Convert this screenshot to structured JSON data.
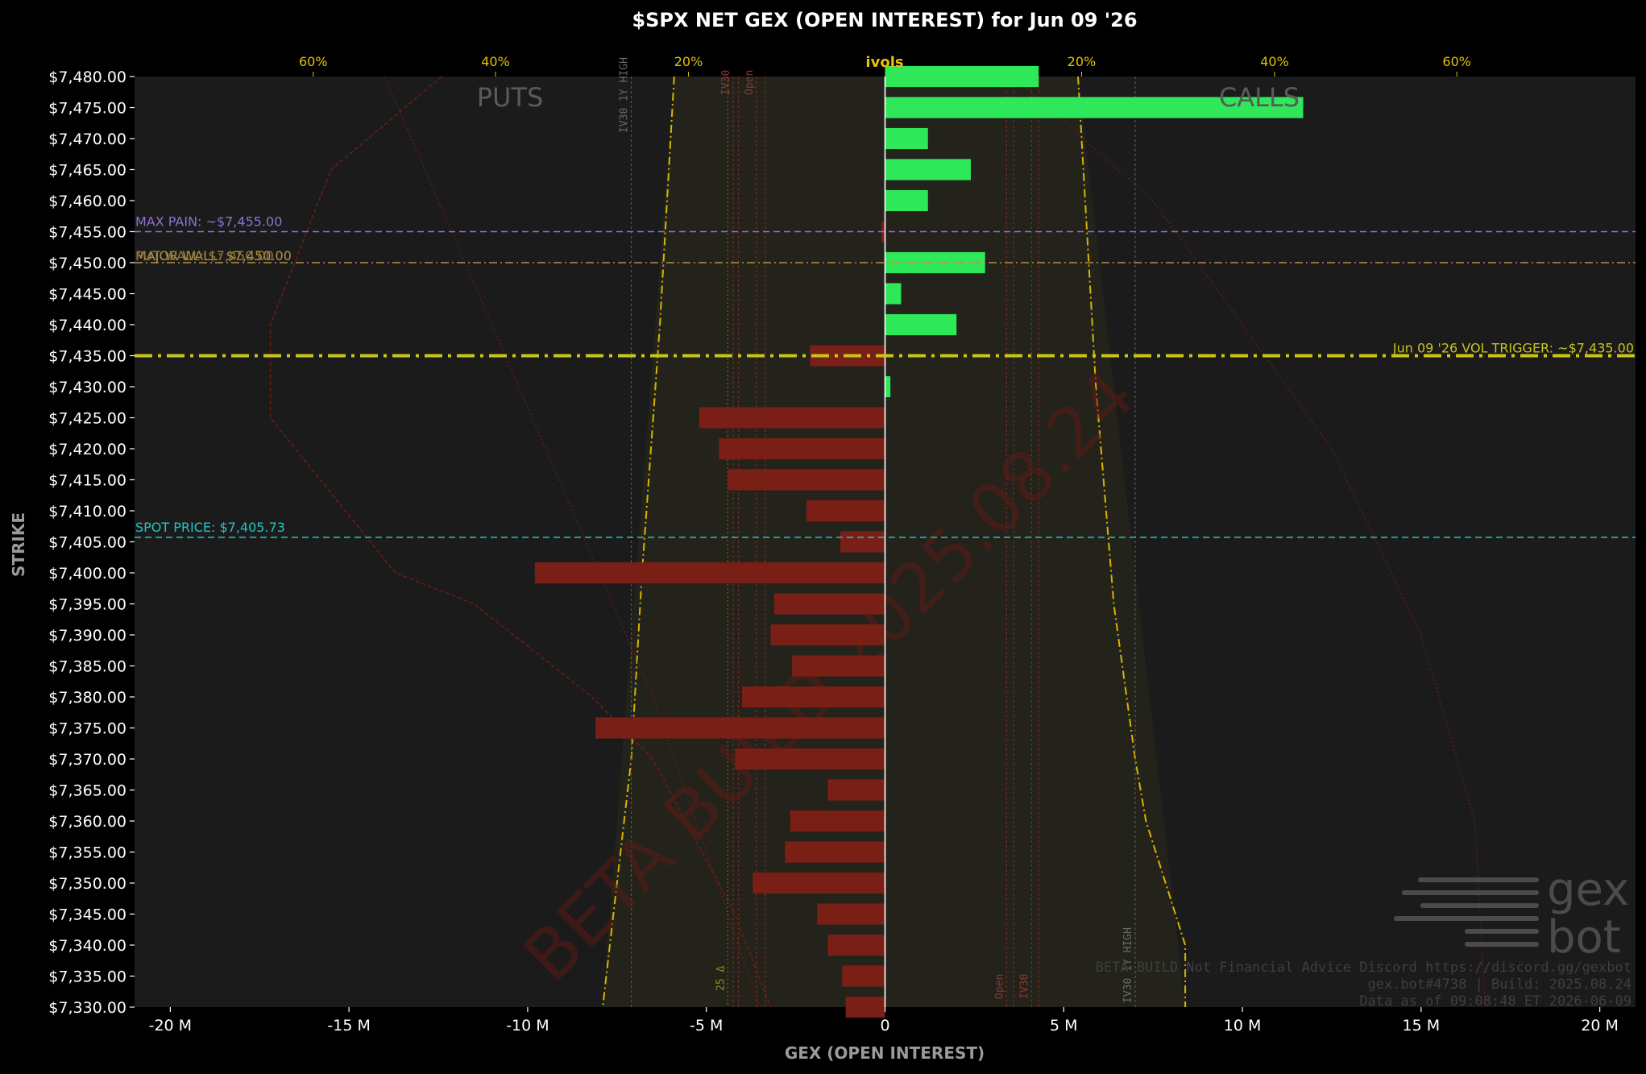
{
  "title": "$SPX NET GEX (OPEN INTEREST) for Jun 09 '26",
  "xlabel": "GEX (OPEN INTEREST)",
  "ylabel": "STRIKE",
  "ivols_label": "ivols",
  "puts_label": "PUTS",
  "calls_label": "CALLS",
  "colors": {
    "background": "#000000",
    "plot_bg": "#1b1b1b",
    "positive": "#2ee85a",
    "negative": "#7a1f16",
    "max_pain": "#8f70d6",
    "major_wall": "#b59243",
    "vol_trigger": "#c9c418",
    "spot": "#22c5c5",
    "ivol": "#d9b400"
  },
  "levels": {
    "max_pain": "MAX PAIN: ~$7,455.00",
    "major_wall_1": "MAJOR WALL: $7,450.00",
    "major_wall_2": "PUT WALL: $7,450.00",
    "vol_trigger": "Jun 09 '26 VOL TRIGGER: ~$7,435.00",
    "spot": "SPOT PRICE: $7,405.73"
  },
  "vertical_labels": {
    "iv30_high_put": "IV30 1Y HIGH",
    "iv30_put": "IV30",
    "open_put": "Open",
    "iv30_high_call": "IV30 1Y HIGH",
    "iv30_call": "IV30",
    "open_call": "Open",
    "delta25": "25 Δ"
  },
  "footer": {
    "line1": "BETA BUILD Not Financial Advice Discord https://discord.gg/gexbot",
    "line2": "gex.bot#4738 | Build: 2025.08.24",
    "line3": "Data as of 09:08:48 ET 2026-06-09"
  },
  "watermark": "BETA BUILD 2025.08.24",
  "logo": {
    "line1": "gex",
    "line2": "bot"
  },
  "chart_data": {
    "type": "bar",
    "orientation": "horizontal",
    "title": "$SPX NET GEX (OPEN INTEREST) for Jun 09 '26",
    "xlabel": "GEX (OPEN INTEREST)",
    "ylabel": "STRIKE",
    "xlim": [
      -21,
      21
    ],
    "ylim": [
      7330,
      7480
    ],
    "x_ticks": [
      "-20 M",
      "-15 M",
      "-10 M",
      "-5 M",
      "0",
      "5 M",
      "10 M",
      "15 M",
      "20 M"
    ],
    "x_tick_values": [
      -20,
      -15,
      -10,
      -5,
      0,
      5,
      10,
      15,
      20
    ],
    "ivol_ticks": [
      "60%",
      "40%",
      "20%",
      "20%",
      "40%",
      "60%"
    ],
    "ivol_tick_values": [
      -16,
      -10.9,
      -5.5,
      5.5,
      10.9,
      16
    ],
    "strike_labels": [
      "$7,480.00",
      "$7,475.00",
      "$7,470.00",
      "$7,465.00",
      "$7,460.00",
      "$7,455.00",
      "$7,450.00",
      "$7,445.00",
      "$7,440.00",
      "$7,435.00",
      "$7,430.00",
      "$7,425.00",
      "$7,420.00",
      "$7,415.00",
      "$7,410.00",
      "$7,405.00",
      "$7,400.00",
      "$7,395.00",
      "$7,390.00",
      "$7,385.00",
      "$7,380.00",
      "$7,375.00",
      "$7,370.00",
      "$7,365.00",
      "$7,360.00",
      "$7,355.00",
      "$7,350.00",
      "$7,345.00",
      "$7,340.00",
      "$7,335.00",
      "$7,330.00"
    ],
    "strikes": [
      7480,
      7475,
      7470,
      7465,
      7460,
      7455,
      7450,
      7445,
      7440,
      7435,
      7430,
      7425,
      7420,
      7415,
      7410,
      7405,
      7400,
      7395,
      7390,
      7385,
      7380,
      7375,
      7370,
      7365,
      7360,
      7355,
      7350,
      7345,
      7340,
      7335,
      7330
    ],
    "values": [
      4.3,
      11.7,
      1.2,
      2.4,
      1.2,
      -0.1,
      2.8,
      0.45,
      2.0,
      -2.1,
      0.15,
      -5.2,
      -4.65,
      -4.4,
      -2.2,
      -1.25,
      -9.8,
      -3.1,
      -3.2,
      -2.6,
      -4.0,
      -8.1,
      -4.2,
      -1.6,
      -2.65,
      -2.8,
      -3.7,
      -1.9,
      -1.6,
      -1.2,
      -1.1
    ],
    "max_pain": 7455,
    "put_wall": 7450,
    "vol_trigger": 7435,
    "spot_price": 7405.73,
    "grid": false,
    "legend": "none"
  }
}
